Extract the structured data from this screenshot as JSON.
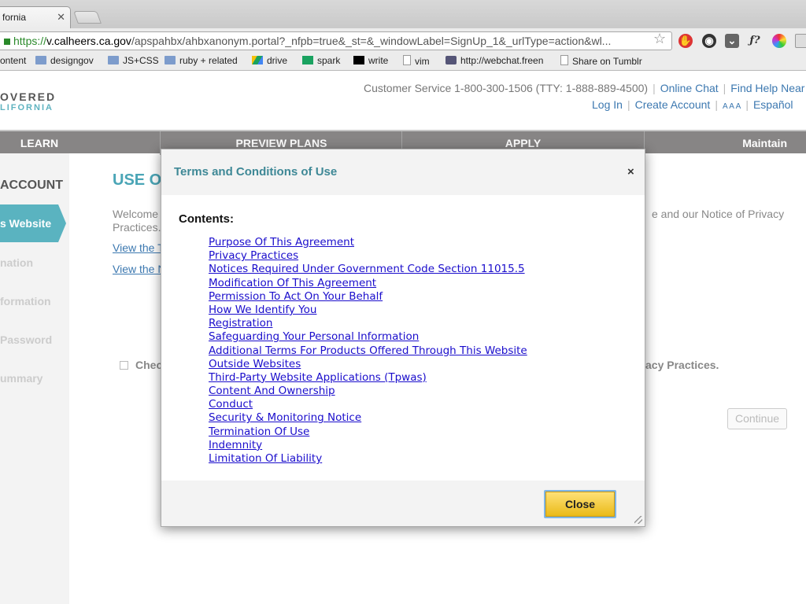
{
  "browser": {
    "tab_title": "fornia",
    "url_scheme": "https://",
    "url_host": "v.calheers.ca.gov",
    "url_path": "/apspahbx/ahbxanonym.portal?_nfpb=true&_st=&_windowLabel=SignUp_1&_urlType=action&wl...",
    "bookmarks": [
      "ontent",
      "designgov",
      "JS+CSS",
      "ruby + related",
      "drive",
      "spark",
      "write",
      "vim",
      "http://webchat.freen",
      "Share on Tumblr"
    ]
  },
  "header": {
    "logo_line1": "OVERED",
    "logo_line2": "LIFORNIA",
    "customer_service": "Customer Service 1-800-300-1506 (TTY: 1-888-889-4500)",
    "online_chat": "Online Chat",
    "find_help": "Find Help Near",
    "log_in": "Log In",
    "create_account": "Create Account",
    "text_size": "A A A",
    "espanol": "Español"
  },
  "nav": [
    "LEARN",
    "PREVIEW PLANS",
    "APPLY",
    "Maintain"
  ],
  "sidebar": {
    "heading": "ACCOUNT",
    "active_item": "s Website",
    "items": [
      "nation",
      "formation",
      "Password",
      "ummary"
    ]
  },
  "main": {
    "title": "USE O",
    "welcome": "Welcome",
    "practices": "Practices.",
    "notice_right": "e and our Notice of Privacy",
    "view_link_1": "View the T",
    "view_link_2": "View the N",
    "checkbox_label": "Chec",
    "privacy_right": "acy Practices.",
    "continue": "Continue"
  },
  "modal": {
    "title": "Terms and Conditions of Use",
    "close_x": "×",
    "contents_label": "Contents:",
    "toc": [
      "Purpose Of This Agreement",
      "Privacy Practices",
      "Notices Required Under Government Code Section 11015.5",
      "Modification Of This Agreement",
      "Permission To Act On Your Behalf",
      "How We Identify You",
      "Registration",
      "Safeguarding Your Personal Information",
      "Additional Terms For Products Offered Through This Website",
      "Outside Websites",
      "Third-Party Website Applications (Tpwas)",
      "Content And Ownership",
      "Conduct",
      "Security & Monitoring Notice",
      "Termination Of Use",
      "Indemnity",
      "Limitation Of Liability"
    ],
    "close_button": "Close"
  },
  "colors": {
    "accent_teal": "#4aa5b6",
    "nav_gray": "#878585",
    "link_blue": "#1a0dcc",
    "button_gold": "#e9b915"
  }
}
